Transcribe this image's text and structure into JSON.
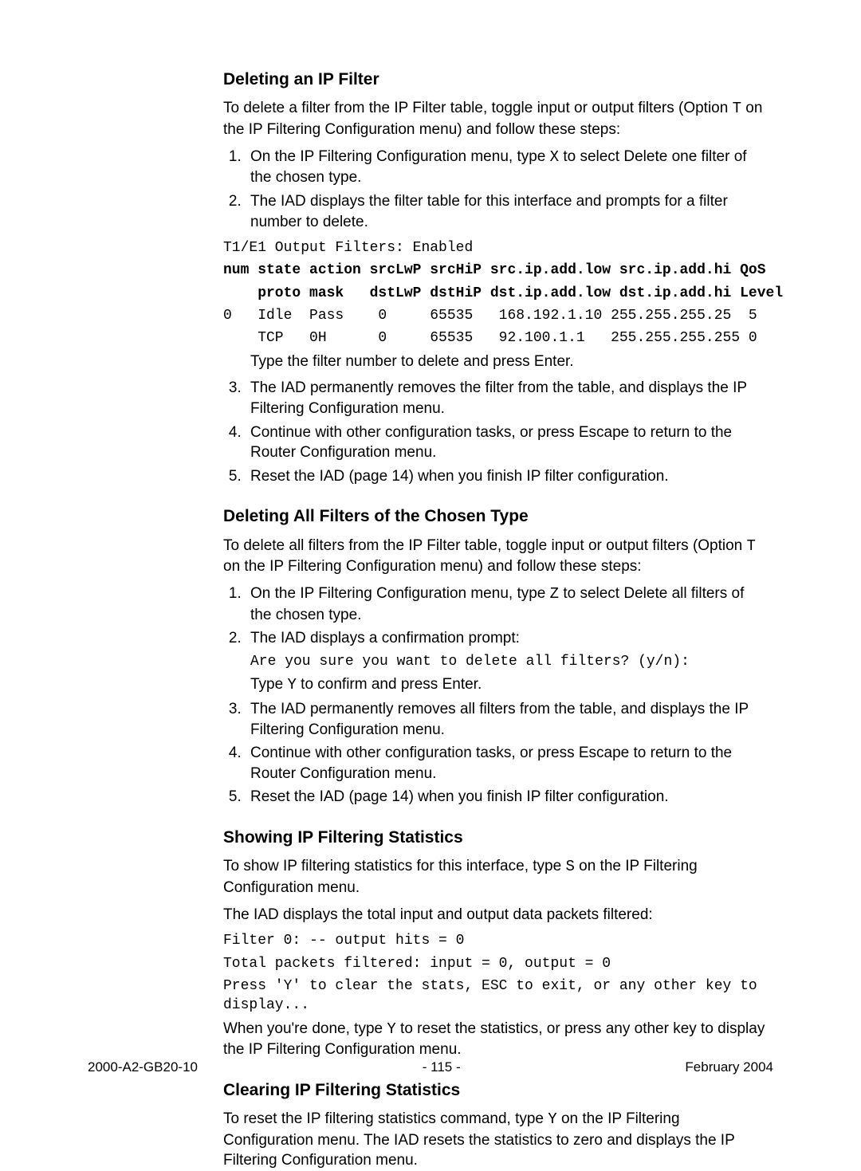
{
  "s1": {
    "heading": "Deleting an IP Filter",
    "intro_a": "To delete a filter from the IP Filter table, toggle input or output filters (Option ",
    "intro_key": "T",
    "intro_b": " on the IP Filtering Configuration menu) and follow these steps:",
    "li1_a": "On the IP Filtering Configuration menu, type ",
    "li1_key": "X",
    "li1_b": " to select Delete one filter of the chosen type.",
    "li2": "The IAD displays the filter table for this interface and prompts for a filter number to delete.",
    "pre1": "T1/E1 Output Filters: Enabled",
    "pre2": "num state action srcLwP srcHiP src.ip.add.low src.ip.add.hi QoS",
    "pre3": "    proto mask   dstLwP dstHiP dst.ip.add.low dst.ip.add.hi Level",
    "pre4": "0   Idle  Pass    0     65535   168.192.1.10 255.255.255.25  5",
    "pre5": "    TCP   0H      0     65535   92.100.1.1   255.255.255.255 0",
    "sub2": "Type the filter number to delete and press Enter.",
    "li3": "The IAD permanently removes the filter from the table, and displays the IP Filtering Configuration menu.",
    "li4": "Continue with other configuration tasks, or press Escape to return to the Router Configuration menu.",
    "li5": "Reset the IAD (page 14) when you finish IP filter configuration."
  },
  "s2": {
    "heading": "Deleting All Filters of the Chosen Type",
    "intro_a": "To delete all filters from the IP Filter table, toggle input or output filters (Option ",
    "intro_key": "T",
    "intro_b": " on the IP Filtering Configuration menu) and follow these steps:",
    "li1_a": "On the IP Filtering Configuration menu, type ",
    "li1_key": "Z",
    "li1_b": " to select Delete all filters of the chosen type.",
    "li2": "The IAD displays a confirmation prompt:",
    "pre1": "Are you sure you want to delete all filters? (y/n):",
    "sub2_a": "Type ",
    "sub2_key": "Y",
    "sub2_b": " to confirm and press Enter.",
    "li3": "The IAD permanently removes all filters from the table, and displays the IP Filtering Configuration menu.",
    "li4": "Continue with other configuration tasks, or press Escape to return to the Router Configuration menu.",
    "li5": "Reset the IAD (page 14) when you finish IP filter configuration."
  },
  "s3": {
    "heading": "Showing IP Filtering Statistics",
    "intro_a": "To show IP filtering statistics for this interface, type ",
    "intro_key": "S",
    "intro_b": " on the IP Filtering Configuration menu.",
    "p2": "The IAD displays the total input and output data packets filtered:",
    "pre1": "Filter 0: -- output hits = 0",
    "pre2": "Total packets filtered: input = 0, output = 0",
    "pre3": "Press 'Y' to clear the stats, ESC to exit, or any other key to display...",
    "p3_a": "When you're done, type ",
    "p3_key": "Y",
    "p3_b": " to reset the statistics, or press any other key to display the IP Filtering Configuration menu."
  },
  "s4": {
    "heading": "Clearing IP Filtering Statistics",
    "intro_a": "To reset the IP filtering statistics command, type ",
    "intro_key": "Y",
    "intro_b": " on the IP Filtering Configuration menu. The IAD resets the statistics to zero and displays the IP Filtering Configuration menu."
  },
  "footer": {
    "left": "2000-A2-GB20-10",
    "center": "- 115 -",
    "right": "February 2004"
  }
}
